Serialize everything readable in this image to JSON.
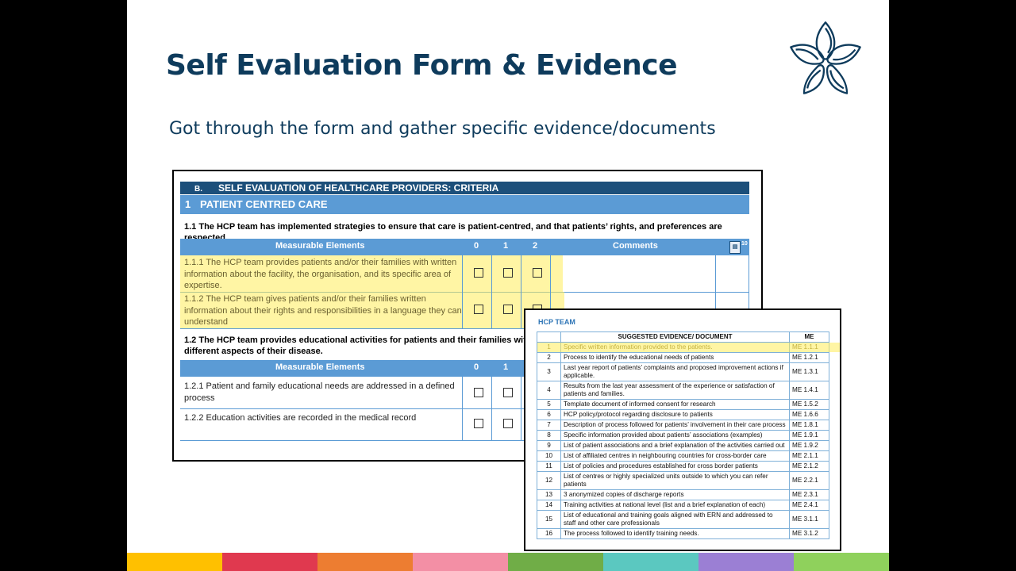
{
  "slide": {
    "title": "Self Evaluation Form & Evidence",
    "subtitle": "Got through the form and gather specific evidence/documents"
  },
  "form": {
    "header_letter": "B.",
    "header_text": "SELF EVALUATION OF HEALTHCARE PROVIDERS: CRITERIA",
    "section_number": "1",
    "section_title": "PATIENT CENTRED CARE",
    "criterion_1": "1.1 The HCP team has implemented strategies to ensure that care is patient-centred, and that patients’ rights, and preferences are respected.",
    "criterion_2": "1.2 The HCP team provides educational activities for patients and their families with th capacity for self-management to face the different aspects of their disease.",
    "col_measurable": "Measurable Elements",
    "col_0": "0",
    "col_1": "1",
    "col_2": "2",
    "col_comments": "Comments",
    "comment_icon_num": "10",
    "me_1_1_1": "1.1.1 The HCP team provides patients and/or their families with written information about the facility, the organisation, and its specific area of expertise.",
    "me_1_1_2": "1.1.2 The HCP team gives patients and/or their families written information about their rights and responsibilities in a language they can understand",
    "me_1_2_1": "1.2.1 Patient and family educational needs are addressed in a defined process",
    "me_1_2_2": "1.2.2 Education activities are recorded in the medical record"
  },
  "evidence": {
    "title": "HCP TEAM",
    "head_doc": "SUGGESTED EVIDENCE/ DOCUMENT",
    "head_me": "ME",
    "rows": [
      {
        "n": "1",
        "doc": "Specific written information provided to the patients.",
        "me": "ME 1.1.1"
      },
      {
        "n": "2",
        "doc": "Process to identify the educational needs of patients",
        "me": "ME 1.2.1"
      },
      {
        "n": "3",
        "doc": "Last year report of patients’ complaints and proposed improvement actions if applicable.",
        "me": "ME 1.3.1"
      },
      {
        "n": "4",
        "doc": "Results from the last year assessment of the experience or satisfaction of patients and families.",
        "me": "ME 1.4.1"
      },
      {
        "n": "5",
        "doc": "Template document of informed consent for research",
        "me": "ME 1.5.2"
      },
      {
        "n": "6",
        "doc": "HCP policy/protocol regarding disclosure to patients",
        "me": "ME 1.6.6"
      },
      {
        "n": "7",
        "doc": "Description of process followed for patients’ involvement in their care process",
        "me": "ME 1.8.1"
      },
      {
        "n": "8",
        "doc": "Specific information provided about patients’ associations (examples)",
        "me": "ME 1.9.1"
      },
      {
        "n": "9",
        "doc": "List of patient associations and a brief explanation of the activities carried out",
        "me": "ME 1.9.2"
      },
      {
        "n": "10",
        "doc": "List of affiliated centres in neighbouring countries for cross-border care",
        "me": "ME 2.1.1"
      },
      {
        "n": "11",
        "doc": "List of policies and procedures established for cross border patients",
        "me": "ME 2.1.2"
      },
      {
        "n": "12",
        "doc": "List of centres or highly specialized units outside to which you can refer patients",
        "me": "ME 2.2.1"
      },
      {
        "n": "13",
        "doc": "3 anonymized copies of discharge reports",
        "me": "ME 2.3.1"
      },
      {
        "n": "14",
        "doc": "Training activities at national level (list and a brief explanation of each)",
        "me": "ME 2.4.1"
      },
      {
        "n": "15",
        "doc": "List of educational and training goals aligned with ERN and addressed to staff and other care professionals",
        "me": "ME 3.1.1"
      },
      {
        "n": "16",
        "doc": "The process followed to identify training needs.",
        "me": "ME 3.1.2"
      }
    ]
  },
  "colors": {
    "title": "#0e3b5c",
    "header_dark": "#1c4f7a",
    "header_light": "#5b9bd5",
    "highlight": "#ffec5a",
    "bar": [
      "#ffc000",
      "#e0394f",
      "#ed7d31",
      "#f38fa5",
      "#70ad47",
      "#5bc8c0",
      "#9b7fd4",
      "#8fd15c"
    ]
  }
}
